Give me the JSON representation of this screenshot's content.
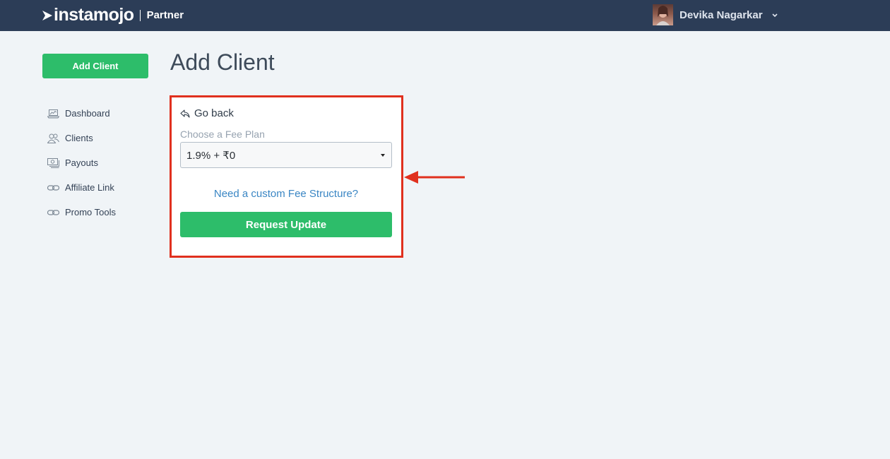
{
  "header": {
    "brand": "instamojo",
    "section": "Partner",
    "user_name": "Devika Nagarkar"
  },
  "sidebar": {
    "add_client_label": "Add Client",
    "items": [
      {
        "label": "Dashboard",
        "icon": "laptop-chart-icon"
      },
      {
        "label": "Clients",
        "icon": "users-icon"
      },
      {
        "label": "Payouts",
        "icon": "payout-icon"
      },
      {
        "label": "Affiliate Link",
        "icon": "link-icon"
      },
      {
        "label": "Promo Tools",
        "icon": "link-icon"
      }
    ]
  },
  "main": {
    "title": "Add Client",
    "panel": {
      "go_back_label": "Go back",
      "fee_plan_label": "Choose a Fee Plan",
      "fee_plan_value": "1.9% + ₹0",
      "custom_fee_link": "Need a custom Fee Structure?",
      "request_button": "Request Update"
    }
  },
  "colors": {
    "topbar": "#2c3d57",
    "accent_green": "#2dbd6a",
    "link_blue": "#3a86c4",
    "annotation_red": "#e0301e"
  }
}
